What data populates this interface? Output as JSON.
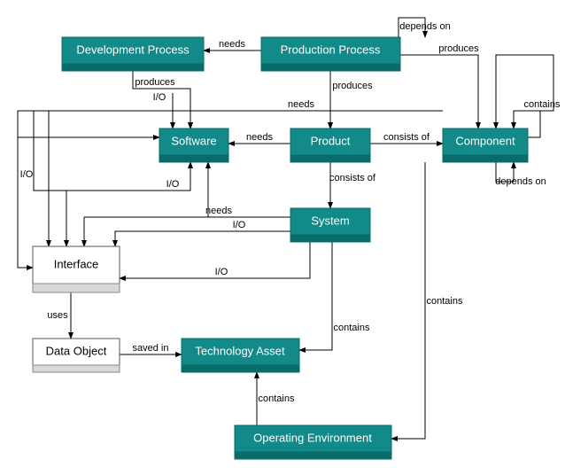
{
  "nodes": {
    "dev_process": "Development Process",
    "prod_process": "Production Process",
    "software": "Software",
    "product": "Product",
    "component": "Component",
    "system": "System",
    "interface": "Interface",
    "data_object": "Data Object",
    "tech_asset": "Technology Asset",
    "op_env": "Operating Environment"
  },
  "labels": {
    "depends_on": "depends on",
    "needs": "needs",
    "produces": "produces",
    "io": "I/O",
    "consists_of": "consists of",
    "contains": "contains",
    "uses": "uses",
    "saved_in": "saved in"
  }
}
